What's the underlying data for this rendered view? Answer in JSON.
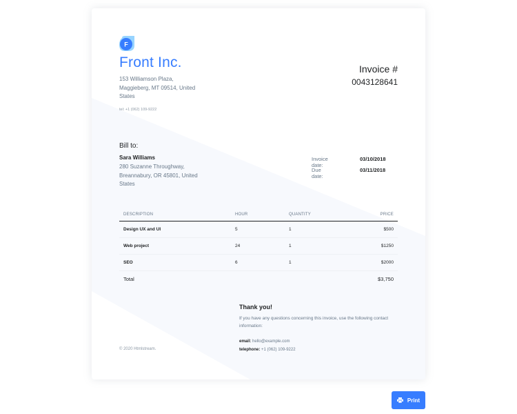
{
  "company": {
    "logo_letter": "F",
    "name": "Front Inc.",
    "address": "153 Williamson Plaza, Maggieberg, MT 09514, United States",
    "phone": "tel: +1 (062) 109-9222"
  },
  "invoice": {
    "title": "Invoice #",
    "number": "0043128641"
  },
  "bill_to": {
    "heading": "Bill to:",
    "name": "Sara Williams",
    "address": "280 Suzanne Throughway, Breannabury, OR 45801, United States"
  },
  "dates": {
    "invoice_label": "Invoice date:",
    "invoice_value": "03/10/2018",
    "due_label": "Due date:",
    "due_value": "03/11/2018"
  },
  "table": {
    "headers": [
      "DESCRIPTION",
      "HOUR",
      "QUANTITY",
      "PRICE"
    ],
    "rows": [
      {
        "description": "Design UX and UI",
        "hour": "5",
        "quantity": "1",
        "price": "$500"
      },
      {
        "description": "Web project",
        "hour": "24",
        "quantity": "1",
        "price": "$1250"
      },
      {
        "description": "SEO",
        "hour": "6",
        "quantity": "1",
        "price": "$2000"
      }
    ],
    "total_label": "Total",
    "total_value": "$3,750"
  },
  "footer": {
    "thanks_title": "Thank you!",
    "thanks_text": "If you have any questions concerning this invoice, use the following contact information:",
    "email_label": "email:",
    "email_value": "hello@example.com",
    "telephone_label": "telephone:",
    "telephone_value": "+1 (062) 109-9222",
    "copyright": "© 2020 Htmlstream."
  },
  "actions": {
    "print_label": "Print",
    "print_icon": "printer-icon"
  },
  "colors": {
    "accent": "#377dff",
    "text_dark": "#1e2022",
    "text_muted": "#677788"
  }
}
